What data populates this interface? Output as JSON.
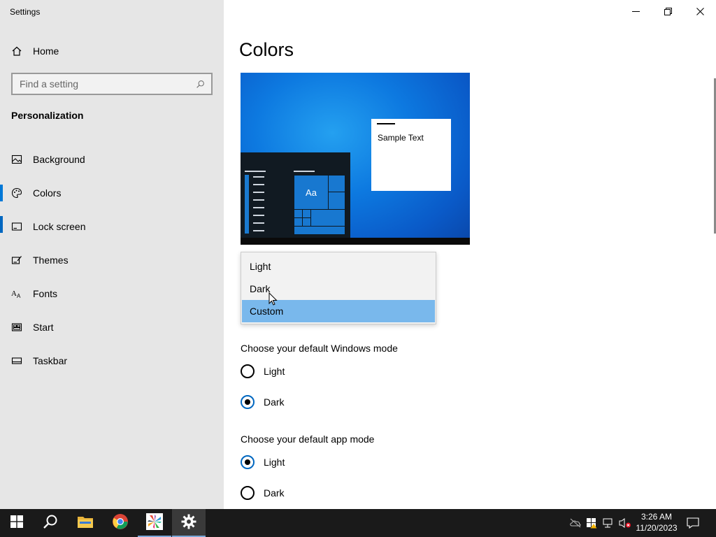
{
  "window": {
    "title": "Settings"
  },
  "sidebar": {
    "home_label": "Home",
    "search_placeholder": "Find a setting",
    "section_title": "Personalization",
    "items": [
      {
        "label": "Background",
        "icon": "picture-icon"
      },
      {
        "label": "Colors",
        "icon": "palette-icon",
        "active": true
      },
      {
        "label": "Lock screen",
        "icon": "lock-screen-icon"
      },
      {
        "label": "Themes",
        "icon": "brush-icon"
      },
      {
        "label": "Fonts",
        "icon": "fonts-icon"
      },
      {
        "label": "Start",
        "icon": "start-icon"
      },
      {
        "label": "Taskbar",
        "icon": "taskbar-icon"
      }
    ]
  },
  "main": {
    "title": "Colors",
    "preview": {
      "sample_text": "Sample Text",
      "tile_text": "Aa"
    },
    "color_dropdown": {
      "options": [
        "Light",
        "Dark",
        "Custom"
      ],
      "selected": "Custom"
    },
    "windows_mode": {
      "label": "Choose your default Windows mode",
      "options": [
        "Light",
        "Dark"
      ],
      "selected": "Dark"
    },
    "app_mode": {
      "label": "Choose your default app mode",
      "options": [
        "Light",
        "Dark"
      ],
      "selected": "Light"
    }
  },
  "taskbar": {
    "apps": [
      "start",
      "search",
      "file-explorer",
      "chrome",
      "app-pinwheel",
      "settings"
    ],
    "clock": {
      "time": "3:26 AM",
      "date": "11/20/2023"
    }
  },
  "colors": {
    "accent": "#0078d7",
    "sidebar_bg": "#e6e6e6",
    "dropdown_selected": "#79b8ec",
    "taskbar_bg": "#1a1a1a"
  }
}
